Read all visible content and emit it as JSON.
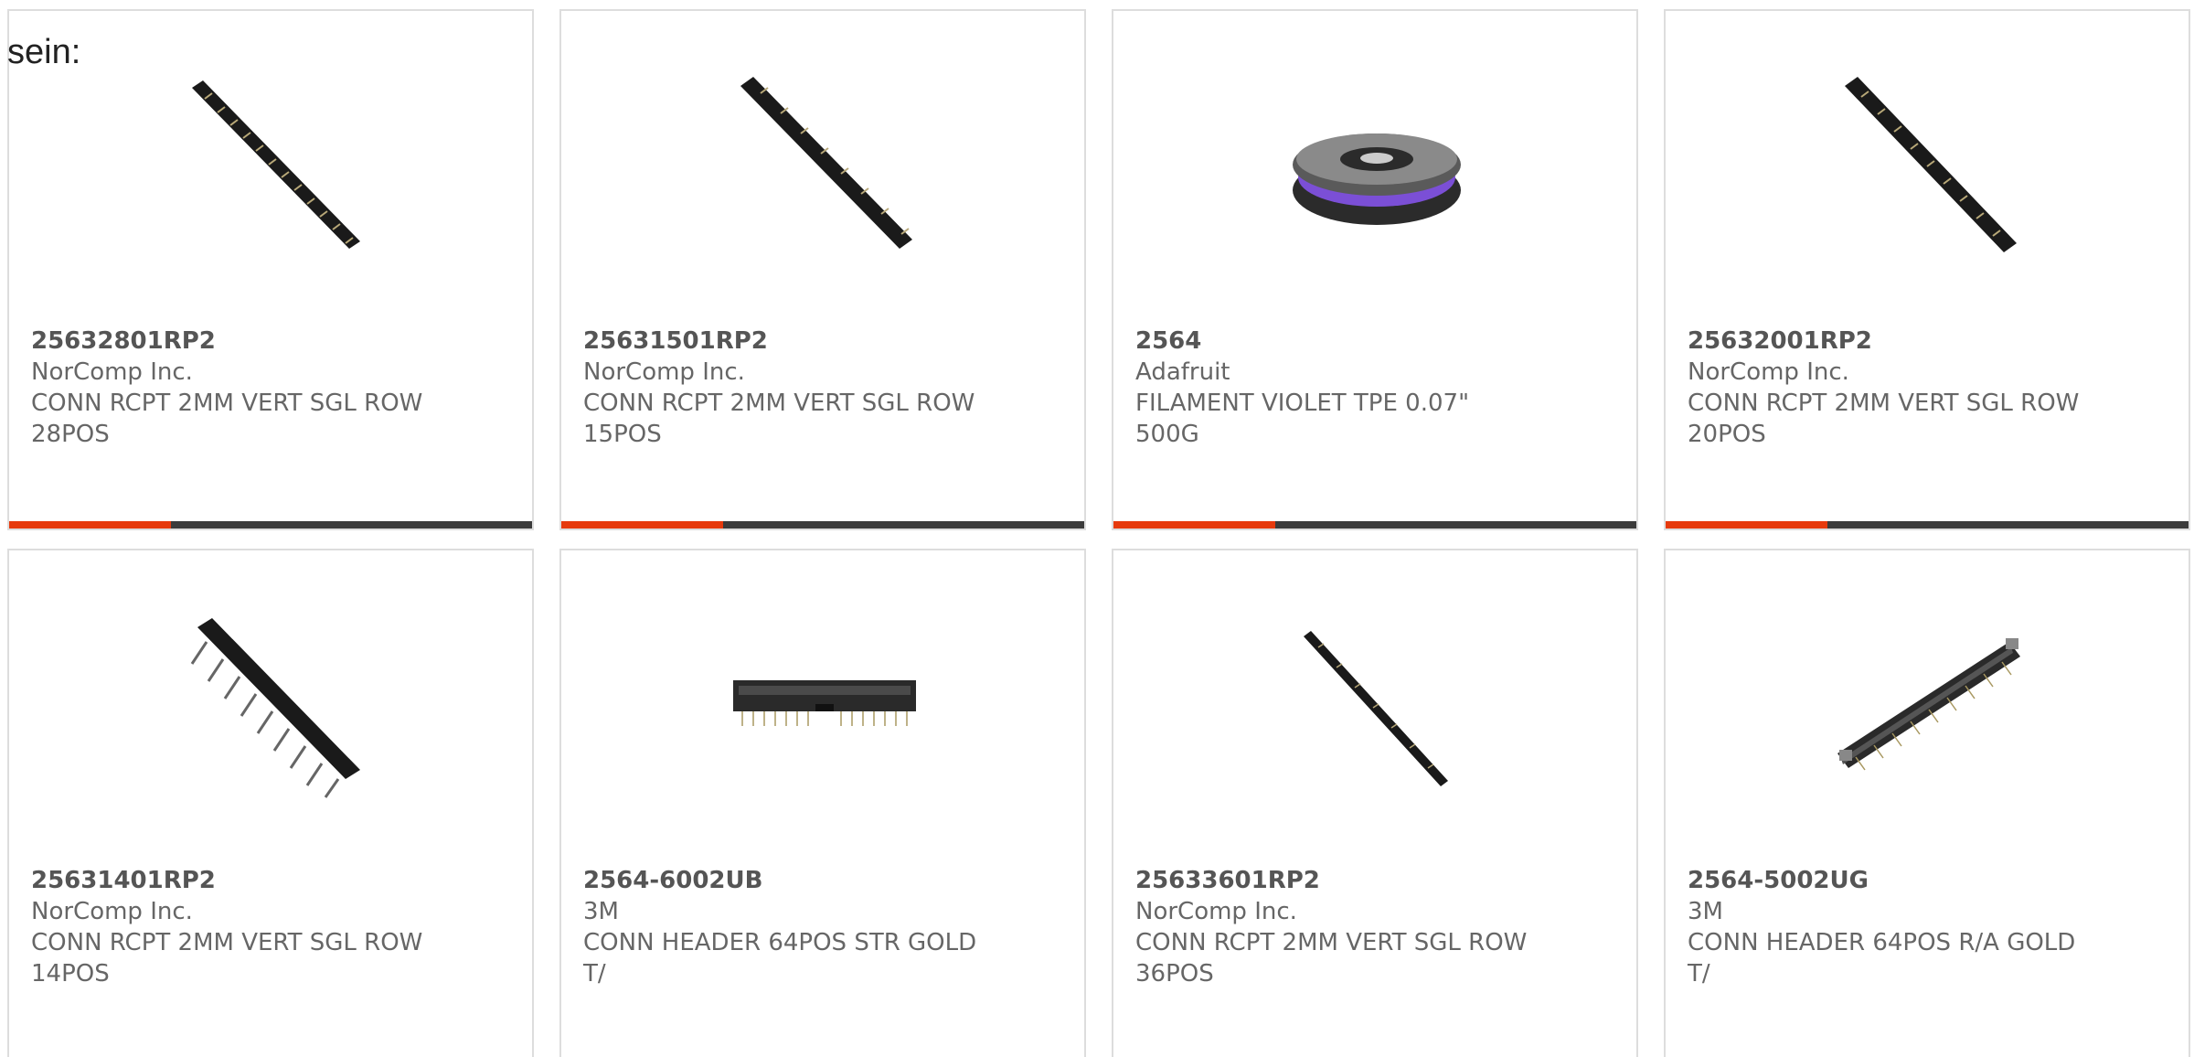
{
  "intro_text": "sein:",
  "accent_color": "#e63a0d",
  "bar_color": "#3b3b3b",
  "products": [
    {
      "part_number": "25632801RP2",
      "manufacturer": "NorComp Inc.",
      "description": "CONN RCPT 2MM VERT SGL ROW 28POS",
      "image": "long-black-header-diagonal-icon"
    },
    {
      "part_number": "25631501RP2",
      "manufacturer": "NorComp Inc.",
      "description": "CONN RCPT 2MM VERT SGL ROW 15POS",
      "image": "black-header-diagonal-icon"
    },
    {
      "part_number": "2564",
      "manufacturer": "Adafruit",
      "description": "FILAMENT VIOLET TPE 0.07\" 500G",
      "image": "filament-spool-icon"
    },
    {
      "part_number": "25632001RP2",
      "manufacturer": "NorComp Inc.",
      "description": "CONN RCPT 2MM VERT SGL ROW 20POS",
      "image": "black-header-diagonal-icon"
    },
    {
      "part_number": "25631401RP2",
      "manufacturer": "NorComp Inc.",
      "description": "CONN RCPT 2MM VERT SGL ROW 14POS",
      "image": "short-header-diagonal-icon"
    },
    {
      "part_number": "2564-6002UB",
      "manufacturer": "3M",
      "description": "CONN HEADER 64POS STR GOLD T/",
      "image": "box-header-horizontal-icon"
    },
    {
      "part_number": "25633601RP2",
      "manufacturer": "NorComp Inc.",
      "description": "CONN RCPT 2MM VERT SGL ROW 36POS",
      "image": "thin-header-diagonal-icon"
    },
    {
      "part_number": "2564-5002UG",
      "manufacturer": "3M",
      "description": "CONN HEADER 64POS R/A GOLD T/",
      "image": "right-angle-header-icon"
    }
  ],
  "progress_fraction": 0.31
}
